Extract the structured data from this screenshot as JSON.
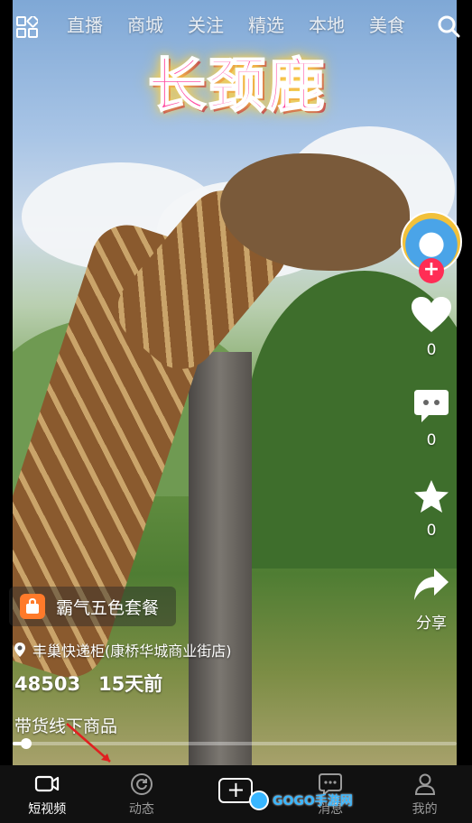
{
  "top_nav": {
    "tabs": [
      "直播",
      "商城",
      "关注",
      "精选",
      "本地",
      "美食"
    ],
    "icons": {
      "menu": "grid-icon",
      "search": "search-icon"
    }
  },
  "video": {
    "title": "长颈鹿"
  },
  "right_rail": {
    "likes": "0",
    "comments": "0",
    "favorites": "0",
    "share_label": "分享"
  },
  "product": {
    "name": "霸气五色套餐"
  },
  "location": "丰巢快递柜(康桥华城商业街店)",
  "stats": {
    "views": "48503",
    "time_ago": "15天前"
  },
  "caption": "带货线下商品",
  "progress": {
    "value": 0.03
  },
  "bottom_bar": {
    "items": [
      {
        "label": "短视频",
        "icon": "video-camera-icon"
      },
      {
        "label": "动态",
        "icon": "refresh-circle-icon"
      },
      {
        "label": "",
        "icon": "plus-icon"
      },
      {
        "label": "消息",
        "icon": "message-icon"
      },
      {
        "label": "我的",
        "icon": "profile-icon"
      }
    ]
  },
  "watermark": "GOGO手游网",
  "colors": {
    "accent_red": "#ff2d55",
    "bag_orange": "#ff7a2a",
    "title_pink": "#ff4aa0"
  }
}
